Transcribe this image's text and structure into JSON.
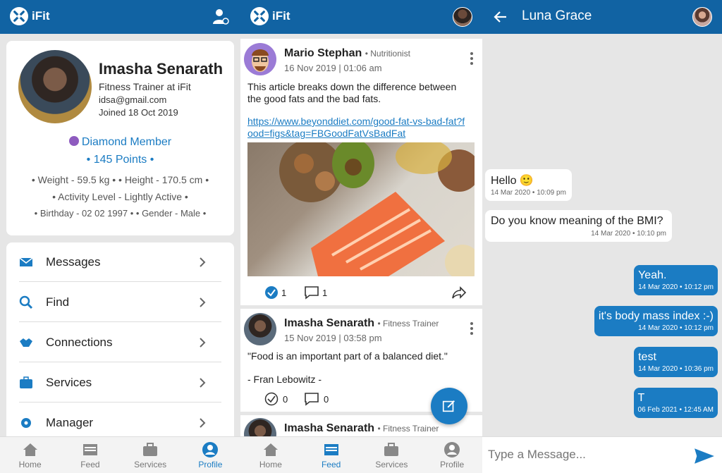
{
  "app": {
    "logo_text": "iFit"
  },
  "profile": {
    "name": "Imasha Senarath",
    "role": "Fitness Trainer at iFit",
    "email": "idsa@gmail.com",
    "joined": "Joined 18 Oct 2019",
    "membership": "Diamond Member",
    "points": "• 145 Points •",
    "line1": "• Weight - 59.5 kg •  • Height - 170.5 cm •",
    "line2": "• Activity Level - Lightly Active •",
    "line3": "• Birthday - 02 02 1997 •  • Gender - Male •"
  },
  "menu": {
    "items": [
      {
        "label": "Messages",
        "icon": "mail-icon"
      },
      {
        "label": "Find",
        "icon": "search-icon"
      },
      {
        "label": "Connections",
        "icon": "handshake-icon"
      },
      {
        "label": "Services",
        "icon": "briefcase-icon"
      },
      {
        "label": "Manager",
        "icon": "gear-icon"
      }
    ]
  },
  "nav1": {
    "home": "Home",
    "feed": "Feed",
    "services": "Services",
    "profile": "Profile"
  },
  "nav2": {
    "home": "Home",
    "feed": "Feed",
    "services": "Services",
    "profile": "Profile"
  },
  "feed": {
    "post1": {
      "author": "Mario Stephan",
      "role": "• Nutritionist",
      "date": "16 Nov 2019",
      "time": "01:06 am",
      "text": "This article breaks down the difference between the good fats and the bad fats.",
      "link": "https://www.beyonddiet.com/good-fat-vs-bad-fat?food=figs&tag=FBGoodFatVsBadFat",
      "likes": "1",
      "comments": "1"
    },
    "post2": {
      "author": "Imasha Senarath",
      "role": "• Fitness Trainer",
      "date": "15 Nov 2019",
      "time": "03:58 pm",
      "quote": "\"Food is an important part of a balanced diet.\"",
      "attribution": "- Fran Lebowitz -",
      "likes": "0",
      "comments": "0"
    },
    "post3": {
      "author": "Imasha Senarath",
      "role": "• Fitness Trainer"
    }
  },
  "chat": {
    "contact": "Luna Grace",
    "input_placeholder": "Type a Message...",
    "messages": [
      {
        "text": "Hello 🙂",
        "meta": "14 Mar 2020 • 10:09 pm"
      },
      {
        "text": "Do you know meaning of the BMI?",
        "meta": "14 Mar 2020 • 10:10 pm"
      },
      {
        "text": "Yeah.",
        "meta": "14 Mar 2020 • 10:12 pm"
      },
      {
        "text": "it's body mass index :-)",
        "meta": "14 Mar 2020 • 10:12 pm"
      },
      {
        "text": "test",
        "meta": "14 Mar 2020 • 10:36 pm"
      },
      {
        "text": "T",
        "meta": "06 Feb 2021 • 12:45 AM"
      }
    ]
  },
  "colors": {
    "primary": "#1163a3",
    "accent": "#1b7cc3",
    "background": "#e6e6e6"
  }
}
